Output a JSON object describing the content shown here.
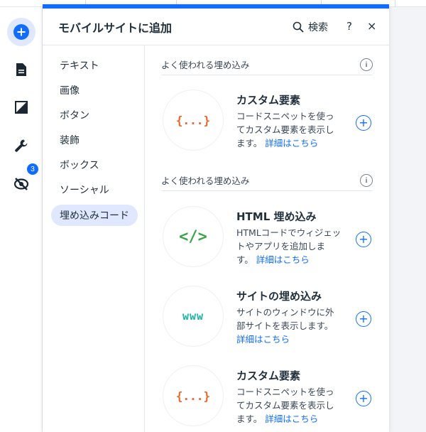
{
  "header": {
    "title": "モバイルサイトに追加",
    "search_label": "検索",
    "help_label": "?",
    "close_label": "×"
  },
  "rail": {
    "badge_count": "3",
    "icons": [
      "add-icon",
      "pages-icon",
      "design-icon",
      "wrench-icon",
      "hidden-icon"
    ]
  },
  "categories": [
    {
      "label": "テキスト"
    },
    {
      "label": "画像"
    },
    {
      "label": "ボタン"
    },
    {
      "label": "装飾"
    },
    {
      "label": "ボックス"
    },
    {
      "label": "ソーシャル"
    },
    {
      "label": "埋め込みコード",
      "active": true
    }
  ],
  "sections": [
    {
      "title": "よく使われる埋め込み",
      "info": "i",
      "items": [
        {
          "icon": "{...}",
          "title": "カスタム要素",
          "desc": "コードスニペットを使ってカスタム要素を表示します。",
          "link": "詳細はこちら"
        }
      ]
    },
    {
      "title": "よく使われる埋め込み",
      "info": "i",
      "items": [
        {
          "icon": "</>",
          "title": "HTML 埋め込み",
          "desc": "HTMLコードでウィジェットやアプリを追加します。",
          "link": "詳細はこちら"
        },
        {
          "icon": "www",
          "title": "サイトの埋め込み",
          "desc": "サイトのウィンドウに外部サイトを表示します。",
          "link": "詳細はこちら"
        },
        {
          "icon": "{...}",
          "title": "カスタム要素",
          "desc": "コードスニペットを使ってカスタム要素を表示します。",
          "link": "詳細はこちら"
        }
      ]
    }
  ],
  "add_symbol": "+",
  "colors": {
    "accent": "#116dff",
    "custom_icon": "#e8662b",
    "html_icon": "#3aa549",
    "www_icon": "#1bb3a8"
  }
}
